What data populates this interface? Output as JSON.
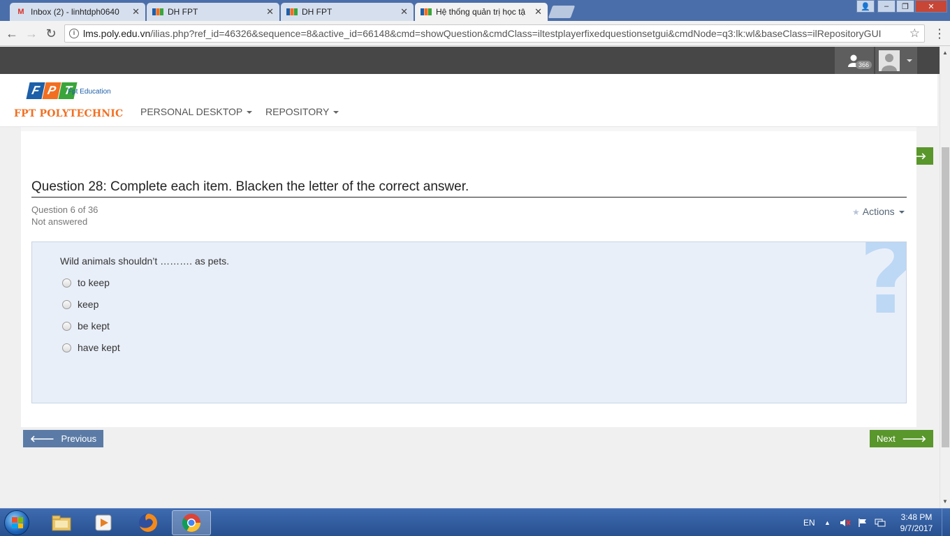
{
  "browser": {
    "tabs": [
      {
        "title": "Inbox (2) - linhtdph0640",
        "icon": "gmail-icon",
        "active": false
      },
      {
        "title": "DH FPT",
        "icon": "fpt-favicon-icon",
        "active": false
      },
      {
        "title": "DH FPT",
        "icon": "fpt-favicon-icon",
        "active": false
      },
      {
        "title": "Hệ thống quản trị học tậ",
        "icon": "fpt-favicon-icon",
        "active": true
      }
    ],
    "url_host": "lms.poly.edu.vn",
    "url_path": "/ilias.php?ref_id=46326&sequence=8&active_id=66148&cmd=showQuestion&cmdClass=iltestplayerfixedquestionsetgui&cmdNode=q3:lk:wl&baseClass=ilRepositoryGUI"
  },
  "topbar": {
    "online_count": "366"
  },
  "header": {
    "logo_letters": [
      "F",
      "P",
      "T"
    ],
    "logo_letter_colors": [
      "#1d5fa8",
      "#f26f21",
      "#3aa53a"
    ],
    "logo_subtitle": "Fpt Education",
    "logo_name": "FPT POLYTECHNIC",
    "nav": [
      {
        "label": "PERSONAL DESKTOP"
      },
      {
        "label": "REPOSITORY"
      }
    ]
  },
  "test": {
    "previous_label": "Previous",
    "next_label": "Next",
    "question_title": "Question 28: Complete each item. Blacken the letter of the correct answer.",
    "progress": "Question 6 of 36",
    "status": "Not answered",
    "actions_label": "Actions",
    "question_text": "Wild animals shouldn’t ………. as pets.",
    "question_mark": "?",
    "options": [
      "to keep",
      "keep",
      "be kept",
      "have kept"
    ]
  },
  "taskbar": {
    "apps": [
      "file-explorer-icon",
      "media-player-icon",
      "firefox-icon",
      "chrome-icon"
    ],
    "language": "EN",
    "time": "3:48 PM",
    "date": "9/7/2017"
  },
  "colors": {
    "prev_button": "#5b7ba6",
    "next_button": "#59962b",
    "question_box": "#e9eff9",
    "brand_orange": "#f26f21"
  }
}
